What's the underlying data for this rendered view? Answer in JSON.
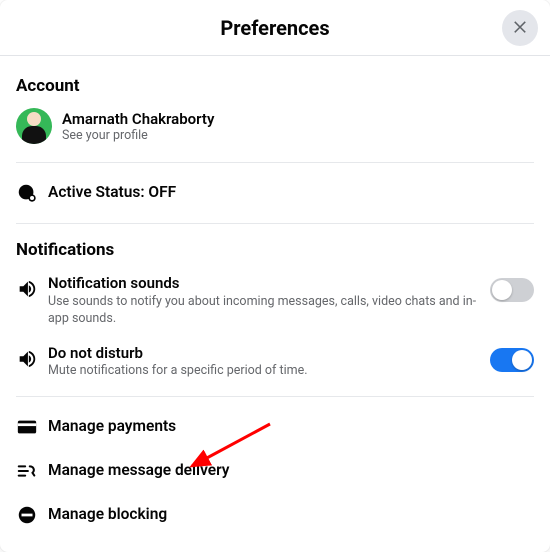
{
  "header": {
    "title": "Preferences"
  },
  "account": {
    "section_label": "Account",
    "profile_name": "Amarnath Chakraborty",
    "profile_sub": "See your profile",
    "active_status_label": "Active Status: OFF"
  },
  "notifications": {
    "section_label": "Notifications",
    "sounds": {
      "label": "Notification sounds",
      "sub": "Use sounds to notify you about incoming messages, calls, video chats and in-app sounds.",
      "on": false
    },
    "dnd": {
      "label": "Do not disturb",
      "sub": "Mute notifications for a specific period of time.",
      "on": true
    }
  },
  "links": {
    "payments": "Manage payments",
    "delivery": "Manage message delivery",
    "blocking": "Manage blocking"
  },
  "colors": {
    "accent": "#1877f2",
    "muted_toggle": "#ced0d4",
    "divider": "#e6e8eb",
    "text_secondary": "#65676b",
    "arrow": "#ff0000"
  }
}
